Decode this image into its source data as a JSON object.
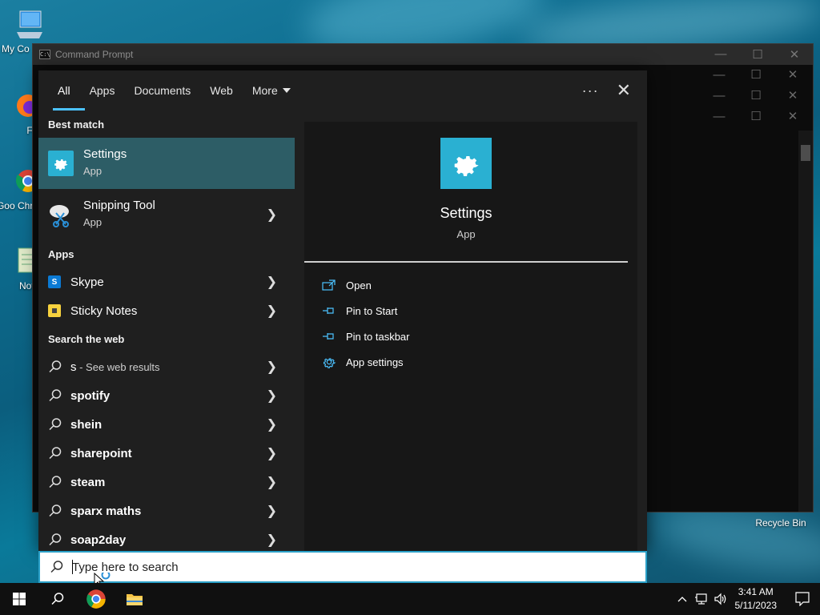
{
  "desktop": {
    "icons": [
      {
        "label": "My Co"
      },
      {
        "label": "Fire"
      },
      {
        "label": "Goo Chro"
      },
      {
        "label": "Notep"
      },
      {
        "label": "Recycle Bin"
      }
    ]
  },
  "cmd_window": {
    "title": "Command Prompt",
    "icon_text": "C:\\"
  },
  "search_panel": {
    "tabs": [
      {
        "label": "All",
        "active": true
      },
      {
        "label": "Apps"
      },
      {
        "label": "Documents"
      },
      {
        "label": "Web"
      },
      {
        "label": "More"
      }
    ],
    "more_dots": "···",
    "close": "✕",
    "best_match_label": "Best match",
    "best_match": [
      {
        "name": "Settings",
        "sub": "App",
        "selected": true,
        "icon": "gear-icon"
      },
      {
        "name": "Snipping Tool",
        "sub": "App",
        "icon": "snipping-tool-icon"
      }
    ],
    "apps_label": "Apps",
    "apps": [
      {
        "name": "Skype",
        "icon": "skype-icon",
        "color": "#0b7ad4"
      },
      {
        "name": "Sticky Notes",
        "icon": "sticky-notes-icon",
        "color": "#f7d23e"
      }
    ],
    "web_label": "Search the web",
    "web": [
      {
        "name": "s",
        "suffix": " - See web results"
      },
      {
        "name": "spotify"
      },
      {
        "name": "shein"
      },
      {
        "name": "sharepoint"
      },
      {
        "name": "steam"
      },
      {
        "name": "sparx maths"
      },
      {
        "name": "soap2day"
      }
    ],
    "detail": {
      "name": "Settings",
      "sub": "App",
      "tile_color": "#2ab0d2",
      "actions": [
        {
          "label": "Open",
          "icon": "open-icon"
        },
        {
          "label": "Pin to Start",
          "icon": "pin-icon"
        },
        {
          "label": "Pin to taskbar",
          "icon": "pin-icon"
        },
        {
          "label": "App settings",
          "icon": "gear-icon"
        }
      ]
    }
  },
  "search_box": {
    "placeholder": "Type here to search",
    "value": ""
  },
  "taskbar": {
    "time": "3:41 AM",
    "date": "5/11/2023"
  },
  "colors": {
    "accent": "#4cc2ff",
    "selected_bg": "#2d5d66",
    "settings_tile": "#2ab0d2"
  }
}
